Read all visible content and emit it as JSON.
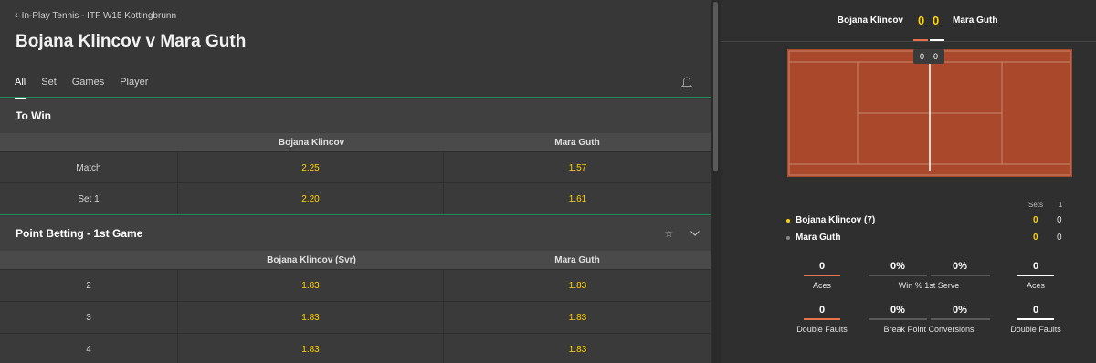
{
  "breadcrumb": "In-Play Tennis - ITF W15 Kottingbrunn",
  "title": "Bojana Klincov v Mara Guth",
  "tabs": [
    "All",
    "Set",
    "Games",
    "Player"
  ],
  "to_win": {
    "heading": "To Win",
    "col1": "Bojana Klincov",
    "col2": "Mara Guth",
    "rows": [
      {
        "label": "Match",
        "odd1": "2.25",
        "odd2": "1.57"
      },
      {
        "label": "Set 1",
        "odd1": "2.20",
        "odd2": "1.61"
      }
    ]
  },
  "point_betting": {
    "heading": "Point Betting - 1st Game",
    "col1": "Bojana Klincov (Svr)",
    "col2": "Mara Guth",
    "rows": [
      {
        "label": "2",
        "odd1": "1.83",
        "odd2": "1.83"
      },
      {
        "label": "3",
        "odd1": "1.83",
        "odd2": "1.83"
      },
      {
        "label": "4",
        "odd1": "1.83",
        "odd2": "1.83"
      }
    ]
  },
  "scoreboard": {
    "player1": "Bojana Klincov",
    "player2": "Mara Guth",
    "score1": "0",
    "score2": "0",
    "court_score1": "0",
    "court_score2": "0",
    "sets_label": "Sets",
    "set_number": "1",
    "rows": [
      {
        "name": "Bojana Klincov (7)",
        "games": "0",
        "set1": "0"
      },
      {
        "name": "Mara Guth",
        "games": "0",
        "set1": "0"
      }
    ]
  },
  "stats": {
    "aces1": "0",
    "aces2": "0",
    "aces_label": "Aces",
    "win1st1": "0%",
    "win1st2": "0%",
    "win1st_label": "Win % 1st Serve",
    "df1": "0",
    "df2": "0",
    "df_label": "Double Faults",
    "bp1": "0%",
    "bp2": "0%",
    "bp_label": "Break Point Conversions"
  },
  "colors": {
    "odds": "#ffd200",
    "accent_green": "#1f8f5a",
    "player1_accent": "#e8734a",
    "court_clay": "#a9482a"
  }
}
